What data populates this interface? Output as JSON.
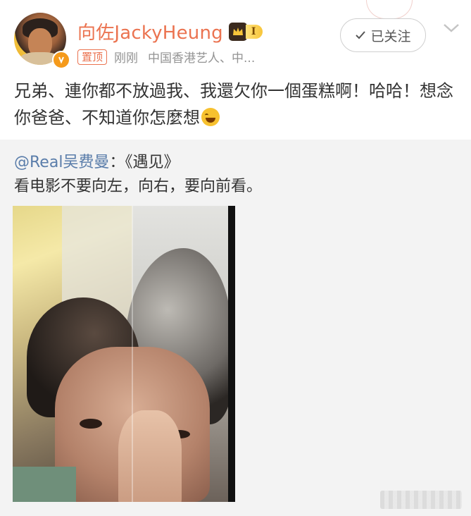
{
  "post": {
    "author": "向佐JackyHeung",
    "vip_level": "I",
    "pin_label": "置顶",
    "time": "刚刚",
    "source": "中国香港艺人、中...",
    "follow_label": "已关注",
    "text": "兄弟、連你都不放過我、我還欠你一個蛋糕啊！哈哈！想念你爸爸、不知道你怎麼想"
  },
  "repost": {
    "user": "@Real吴费曼",
    "title": "：《遇见》",
    "text": "看电影不要向左，向右，要向前看。"
  },
  "colors": {
    "username": "#eb7350",
    "link": "#5a7daa",
    "repost_bg": "#f3f3f3",
    "verified": "#f59a1b"
  },
  "icons": {
    "verified": "verified-badge-icon",
    "vip": "crown-icon",
    "follow": "check-icon",
    "menu": "chevron-down-icon",
    "emoji": "laughing-tears-emoji-icon"
  }
}
